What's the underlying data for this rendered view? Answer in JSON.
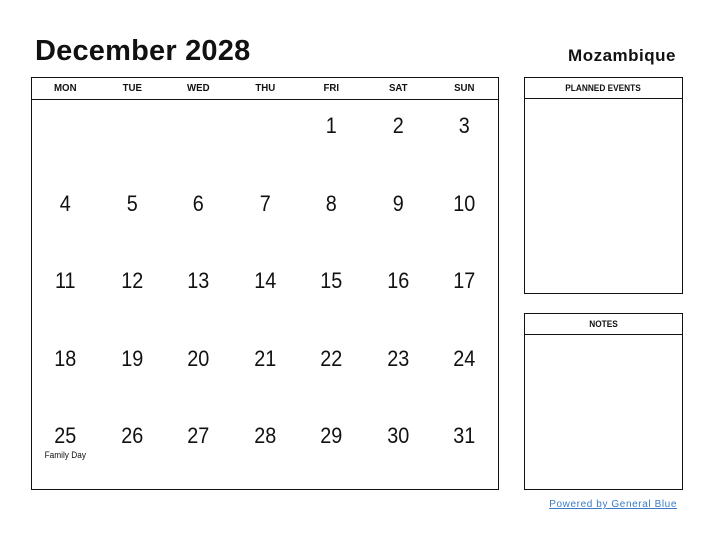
{
  "header": {
    "title": "December 2028",
    "country": "Mozambique"
  },
  "calendar": {
    "weekdays": [
      "MON",
      "TUE",
      "WED",
      "THU",
      "FRI",
      "SAT",
      "SUN"
    ],
    "weeks": [
      [
        {
          "day": ""
        },
        {
          "day": ""
        },
        {
          "day": ""
        },
        {
          "day": ""
        },
        {
          "day": "1"
        },
        {
          "day": "2"
        },
        {
          "day": "3"
        }
      ],
      [
        {
          "day": "4"
        },
        {
          "day": "5"
        },
        {
          "day": "6"
        },
        {
          "day": "7"
        },
        {
          "day": "8"
        },
        {
          "day": "9"
        },
        {
          "day": "10"
        }
      ],
      [
        {
          "day": "11"
        },
        {
          "day": "12"
        },
        {
          "day": "13"
        },
        {
          "day": "14"
        },
        {
          "day": "15"
        },
        {
          "day": "16"
        },
        {
          "day": "17"
        }
      ],
      [
        {
          "day": "18"
        },
        {
          "day": "19"
        },
        {
          "day": "20"
        },
        {
          "day": "21"
        },
        {
          "day": "22"
        },
        {
          "day": "23"
        },
        {
          "day": "24"
        }
      ],
      [
        {
          "day": "25",
          "holiday": "Family Day"
        },
        {
          "day": "26"
        },
        {
          "day": "27"
        },
        {
          "day": "28"
        },
        {
          "day": "29"
        },
        {
          "day": "30"
        },
        {
          "day": "31"
        }
      ]
    ]
  },
  "sidebar": {
    "planned_events_title": "PLANNED EVENTS",
    "notes_title": "NOTES"
  },
  "footer": {
    "powered_by": "Powered by General Blue",
    "link_color": "#3a7cc4"
  }
}
